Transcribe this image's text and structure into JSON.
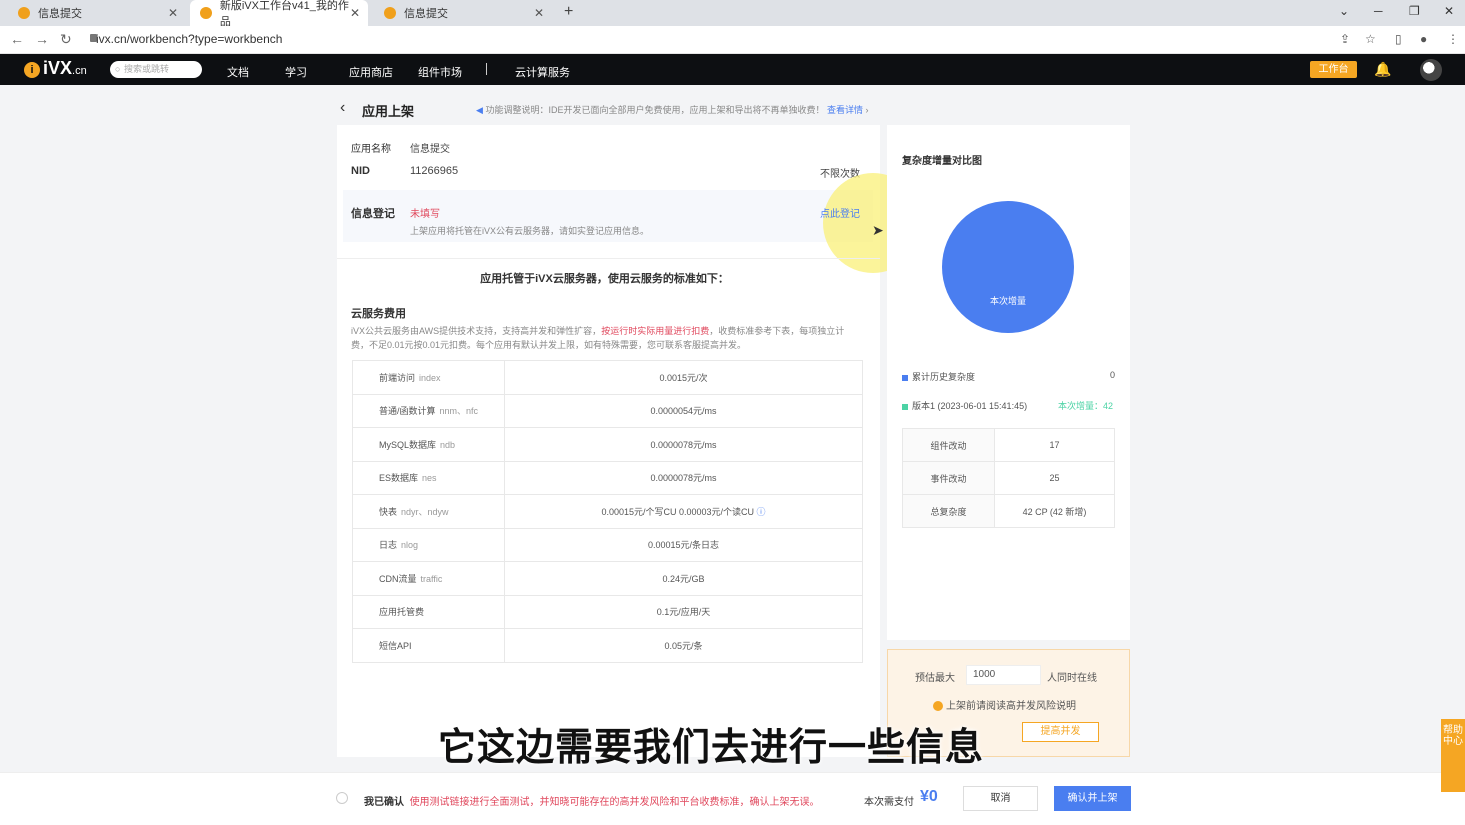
{
  "browser": {
    "tabs": [
      {
        "title": "信息提交"
      },
      {
        "title": "新版iVX工作台v41_我的作品"
      },
      {
        "title": "信息提交"
      }
    ],
    "url": "ivx.cn/workbench?type=workbench"
  },
  "header": {
    "logo": "iVX",
    "logo_suffix": ".cn",
    "search_placeholder": "搜索或跳转",
    "nav": [
      "文档",
      "学习",
      "应用商店",
      "组件市场",
      "云计算服务"
    ],
    "workbench_button": "工作台"
  },
  "page": {
    "title": "应用上架",
    "notice": "功能调整说明：IDE开发已面向全部用户免费使用，应用上架和导出将不再单独收费！",
    "notice_link": "查看详情"
  },
  "app_info": {
    "name_label": "应用名称",
    "name_value": "信息提交",
    "nid_label": "NID",
    "nid_value": "11266965",
    "limit_text": "不限次数",
    "register_label": "信息登记",
    "register_status": "未填写",
    "register_link": "点此登记",
    "register_desc": "上架应用将托管在iVX公有云服务器，请如实登记应用信息。"
  },
  "cloud": {
    "headline": "应用托管于iVX云服务器，使用云服务的标准如下：",
    "section_title": "云服务费用",
    "desc_a": "iVX公共云服务由AWS提供技术支持，支持高并发和弹性扩容，",
    "desc_red": "按运行时实际用量进行扣费",
    "desc_b": "，收费标准参考下表，每项独立计费，不足0.01元按0.01元扣费。每个应用有默认并发上限，如有特殊需要，您可联系客服提高并发。",
    "fees": [
      {
        "name": "前端访问",
        "code": "index",
        "price": "0.0015元/次"
      },
      {
        "name": "普通/函数计算",
        "code": "nnm、nfc",
        "price": "0.0000054元/ms"
      },
      {
        "name": "MySQL数据库",
        "code": "ndb",
        "price": "0.0000078元/ms"
      },
      {
        "name": "ES数据库",
        "code": "nes",
        "price": "0.0000078元/ms"
      },
      {
        "name": "快表",
        "code": "ndyr、ndyw",
        "price": "0.00015元/个写CU  0.00003元/个读CU"
      },
      {
        "name": "日志",
        "code": "nlog",
        "price": "0.00015元/条日志"
      },
      {
        "name": "CDN流量",
        "code": "traffic",
        "price": "0.24元/GB"
      },
      {
        "name": "应用托管费",
        "code": "",
        "price": "0.1元/应用/天"
      },
      {
        "name": "短信API",
        "code": "",
        "price": "0.05元/条"
      }
    ]
  },
  "complexity": {
    "title": "复杂度增量对比图",
    "pie_label": "本次增量",
    "legend": [
      {
        "name": "累计历史复杂度",
        "value": "0",
        "color": "#4a7ef0"
      },
      {
        "name": "版本1 (2023-06-01 15:41:45)",
        "value": "本次增量：42",
        "color": "#4cd3a5"
      }
    ],
    "stats": [
      {
        "key": "组件改动",
        "value": "17"
      },
      {
        "key": "事件改动",
        "value": "25"
      },
      {
        "key": "总复杂度",
        "value": "42 CP (42 新增)"
      }
    ]
  },
  "concurrency": {
    "prefix": "预估最大",
    "input_value": "1000",
    "suffix": "人同时在线",
    "warning": "上架前请阅读高并发风险说明",
    "button": "提高并发"
  },
  "subtitle": "它这边需要我们去进行一些信息",
  "footer": {
    "confirm_prefix": "我已确认",
    "confirm_red": "使用测试链接进行全面测试，并知晓可能存在的高并发风险和平台收费标准，确认上架无误。",
    "pay_label": "本次需支付",
    "pay_amount": "¥0",
    "cancel": "取消",
    "submit": "确认并上架",
    "help": "帮助中心"
  }
}
